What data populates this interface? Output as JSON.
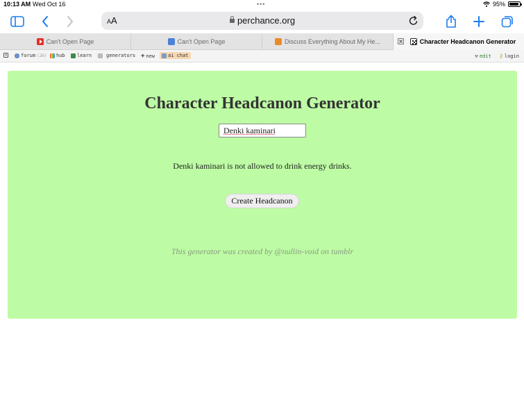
{
  "status": {
    "time": "10:13 AM",
    "date": "Wed Oct 16",
    "battery": "95%",
    "battery_level": 0.95
  },
  "toolbar": {
    "text_size_label": "AA",
    "url": "perchance.org"
  },
  "tabs": [
    {
      "title": "Can't Open Page",
      "icon": "youtube-icon",
      "active": false
    },
    {
      "title": "Can't Open Page",
      "icon": "shield-icon",
      "active": false
    },
    {
      "title": "Discuss Everything About My He...",
      "icon": "site-icon",
      "active": false
    },
    {
      "title": "Character Headcanon Generator",
      "icon": "dice-icon",
      "active": true
    }
  ],
  "nav": {
    "forum": "forum",
    "forum_count": "(26)",
    "hub": "hub",
    "learn": "learn",
    "generators": "generators",
    "new": "new",
    "ai_chat": "ai chat",
    "edit": "edit",
    "login": "login"
  },
  "page": {
    "title": "Character Headcanon Generator",
    "input_value": "Denki kaminari",
    "result": "Denki kaminari is not allowed to drink energy drinks.",
    "button_label": "Create Headcanon",
    "credit": "This generator was created by @nullin-void on tumblr",
    "background": "#bdfca4"
  }
}
